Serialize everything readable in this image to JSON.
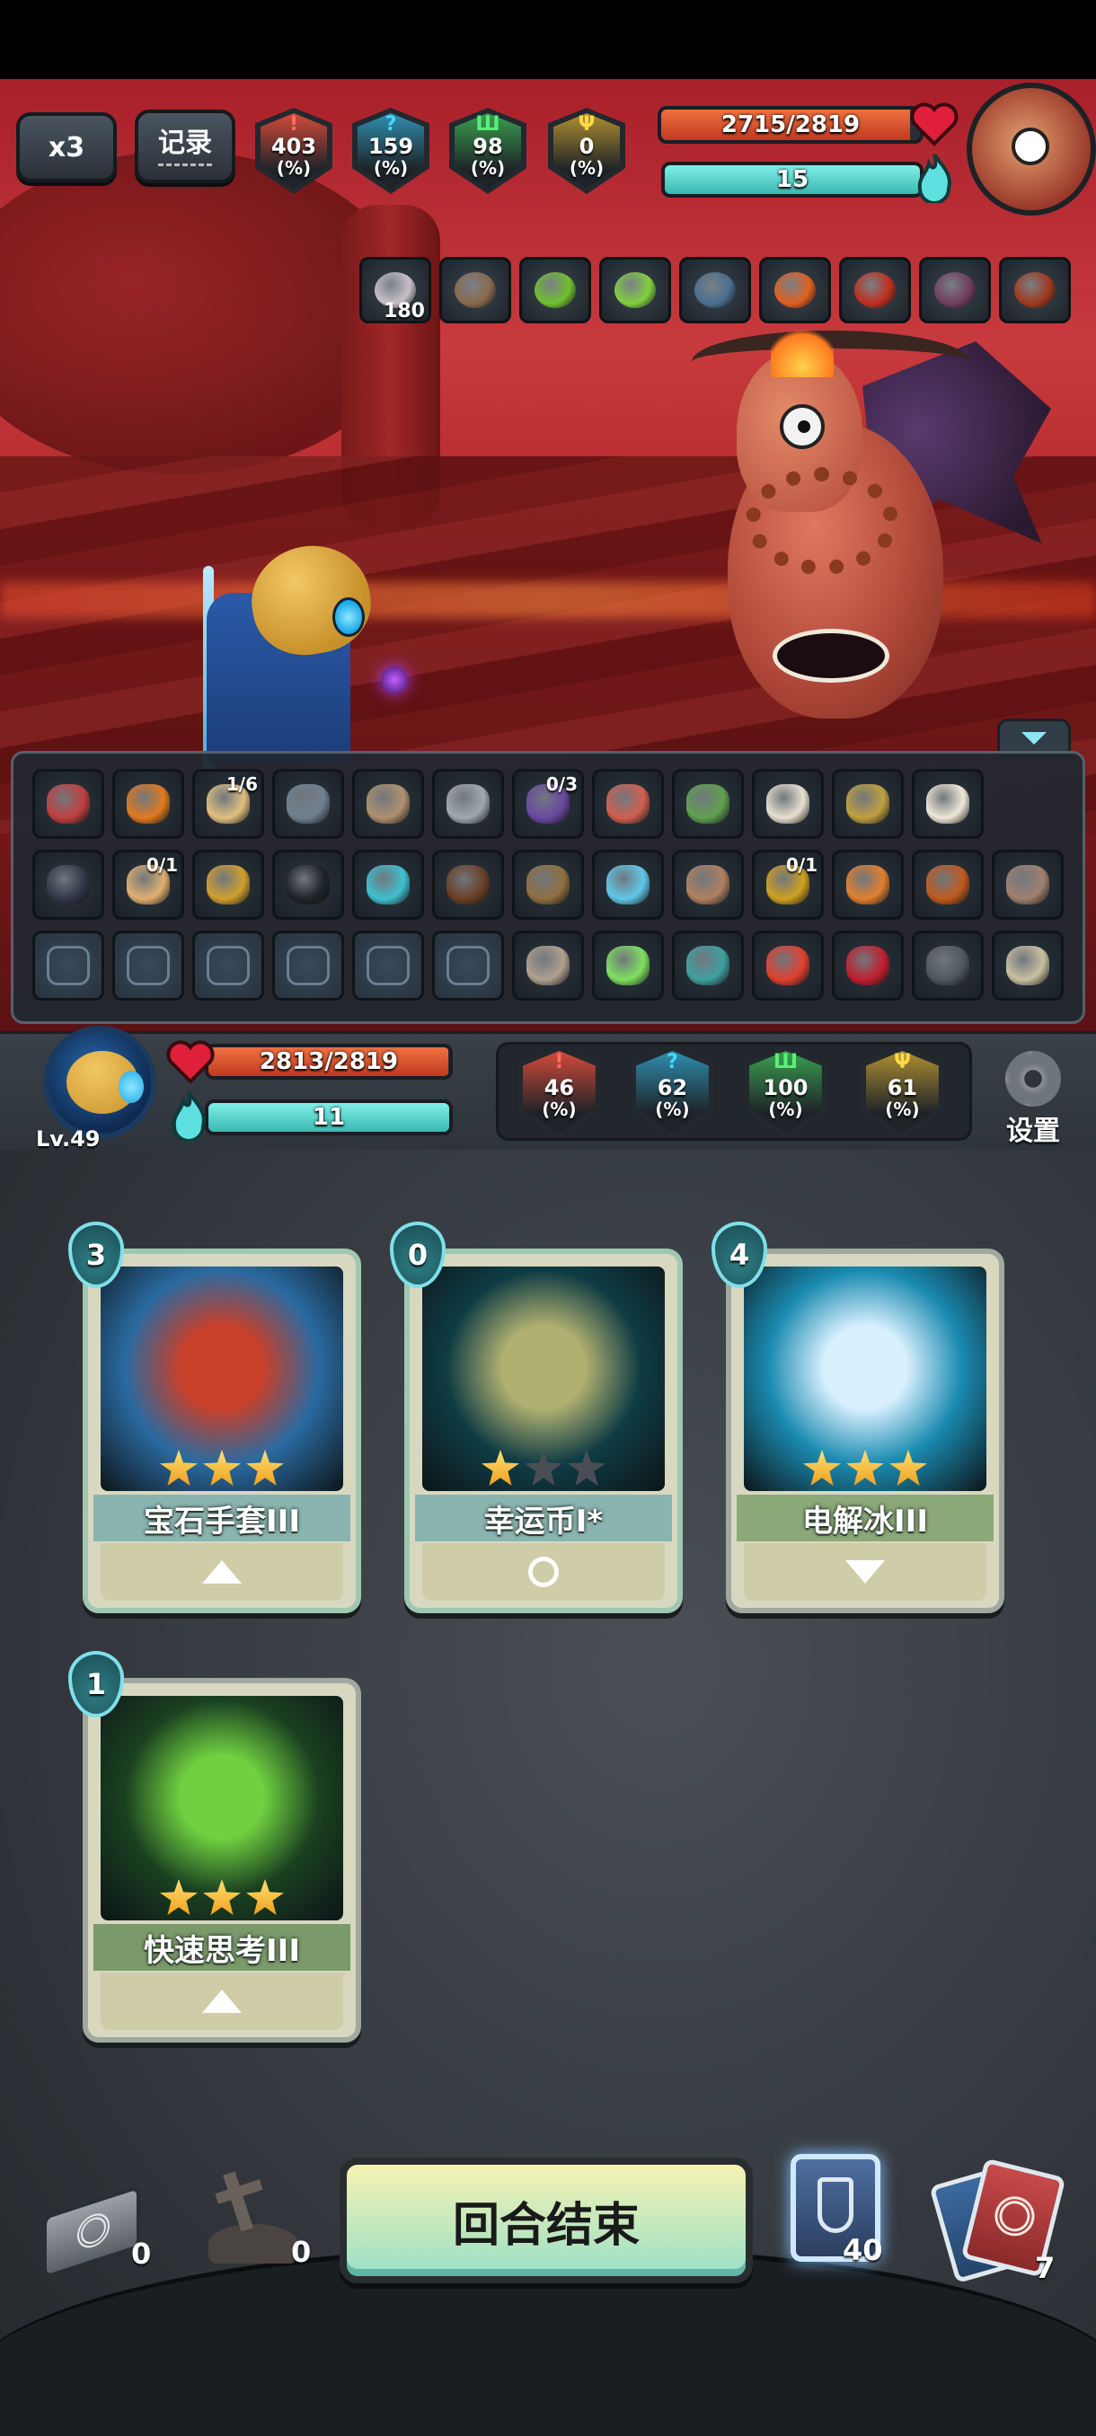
{
  "speed_button": "x3",
  "log_button": "记录",
  "enemy": {
    "stats": [
      {
        "value": "403",
        "unit": "(%)",
        "glyph": "!",
        "color": "#d44a3a"
      },
      {
        "value": "159",
        "unit": "(%)",
        "glyph": "?",
        "color": "#2f8fb0"
      },
      {
        "value": "98",
        "unit": "(%)",
        "glyph": "Ш",
        "color": "#3aa050"
      },
      {
        "value": "0",
        "unit": "(%)",
        "glyph": "Ψ",
        "color": "#b09030"
      }
    ],
    "hp": "2715/2819",
    "hp_fraction": 0.963,
    "mana": "15",
    "relics": [
      {
        "name": "spiral-token",
        "badge": "180",
        "color": "#c8c0c8"
      },
      {
        "name": "spellbook",
        "badge": "",
        "color": "#8a6a50"
      },
      {
        "name": "green-gem",
        "badge": "",
        "color": "#70c030"
      },
      {
        "name": "green-gem-2",
        "badge": "",
        "color": "#80d040"
      },
      {
        "name": "statue",
        "badge": "",
        "color": "#4a7090"
      },
      {
        "name": "flame-shard",
        "badge": "",
        "color": "#e06020"
      },
      {
        "name": "claw",
        "badge": "",
        "color": "#c03020"
      },
      {
        "name": "dark-wing",
        "badge": "",
        "color": "#704060"
      },
      {
        "name": "bead-ring",
        "badge": "",
        "color": "#a03a20"
      }
    ]
  },
  "relic_rows": [
    [
      {
        "name": "clown-face",
        "badge": "",
        "color": "#c04040"
      },
      {
        "name": "fire-torch",
        "badge": "",
        "color": "#e07a20"
      },
      {
        "name": "scroll",
        "badge": "1/6",
        "color": "#e0c080"
      },
      {
        "name": "hammer",
        "badge": "",
        "color": "#708090"
      },
      {
        "name": "mirror",
        "badge": "",
        "color": "#b09070"
      },
      {
        "name": "scales",
        "badge": "",
        "color": "#a0a8b0"
      },
      {
        "name": "tome",
        "badge": "0/3",
        "color": "#6a4aa0"
      },
      {
        "name": "doll",
        "badge": "",
        "color": "#d06050"
      },
      {
        "name": "plant-monster",
        "badge": "",
        "color": "#60a050"
      },
      {
        "name": "dice",
        "badge": "",
        "color": "#e8e0d0"
      },
      {
        "name": "compass",
        "badge": "",
        "color": "#c0a040"
      },
      {
        "name": "ice-cream",
        "badge": "",
        "color": "#f0e8d8"
      }
    ],
    [
      {
        "name": "black-wings",
        "badge": "",
        "color": "#303848"
      },
      {
        "name": "pacifier",
        "badge": "0/1",
        "color": "#e0b070"
      },
      {
        "name": "golden-lamp",
        "badge": "",
        "color": "#d0a030"
      },
      {
        "name": "sunglasses",
        "badge": "",
        "color": "#202428"
      },
      {
        "name": "cyan-orb",
        "badge": "",
        "color": "#40c0d0"
      },
      {
        "name": "sack",
        "badge": "",
        "color": "#6a4028"
      },
      {
        "name": "mask",
        "badge": "",
        "color": "#907040"
      },
      {
        "name": "ice-crystal",
        "badge": "",
        "color": "#60c8e8"
      },
      {
        "name": "shell",
        "badge": "",
        "color": "#b08060"
      },
      {
        "name": "lantern",
        "badge": "0/1",
        "color": "#d0a020"
      },
      {
        "name": "lion-head",
        "badge": "",
        "color": "#e08030"
      },
      {
        "name": "bomb-face",
        "badge": "",
        "color": "#c05a20"
      },
      {
        "name": "bird-bust",
        "badge": "",
        "color": "#a08070"
      }
    ],
    [
      {
        "name": "locked-rune-1",
        "badge": "",
        "color": "",
        "locked": true
      },
      {
        "name": "locked-rune-2",
        "badge": "",
        "color": "",
        "locked": true
      },
      {
        "name": "locked-rune-3",
        "badge": "",
        "color": "",
        "locked": true
      },
      {
        "name": "locked-rune-4",
        "badge": "",
        "color": "",
        "locked": true
      },
      {
        "name": "locked-rune-5",
        "badge": "",
        "color": "",
        "locked": true
      },
      {
        "name": "locked-rune-6",
        "badge": "",
        "color": "",
        "locked": true
      },
      {
        "name": "cauldron",
        "badge": "",
        "color": "#b0a090"
      },
      {
        "name": "green-vial",
        "badge": "",
        "color": "#80e060"
      },
      {
        "name": "fish",
        "badge": "",
        "color": "#40a0a0"
      },
      {
        "name": "strawberry",
        "badge": "",
        "color": "#e04030"
      },
      {
        "name": "red-glove",
        "badge": "",
        "color": "#c02030"
      },
      {
        "name": "bear-trap",
        "badge": "",
        "color": "#505860"
      },
      {
        "name": "bandage-mummy",
        "badge": "",
        "color": "#c8c0a0"
      }
    ]
  ],
  "player": {
    "level": "Lv.49",
    "hp": "2813/2819",
    "hp_fraction": 0.998,
    "mana": "11",
    "stats": [
      {
        "value": "46",
        "unit": "(%)",
        "glyph": "!",
        "color": "#d44a3a"
      },
      {
        "value": "62",
        "unit": "(%)",
        "glyph": "?",
        "color": "#2f8fb0"
      },
      {
        "value": "100",
        "unit": "(%)",
        "glyph": "Ш",
        "color": "#3aa050"
      },
      {
        "value": "61",
        "unit": "(%)",
        "glyph": "Ψ",
        "color": "#b09030"
      }
    ]
  },
  "settings_label": "设置",
  "cards": [
    {
      "cost": "3",
      "name": "宝石手套III",
      "stars": 3,
      "footer": "arrow-up",
      "frame": "#a0c8b0",
      "name_bg": "#8ab4b0",
      "art": [
        "#2a6aa0",
        "#c8402a"
      ]
    },
    {
      "cost": "0",
      "name": "幸运币I*",
      "stars": 1,
      "footer": "bulb",
      "frame": "#a0c8b0",
      "name_bg": "#8ab4b0",
      "art": [
        "#0f3c44",
        "#b0b070"
      ]
    },
    {
      "cost": "4",
      "name": "电解冰III",
      "stars": 3,
      "footer": "arrow-down",
      "frame": "#a0a8a0",
      "name_bg": "#8aa878",
      "art": [
        "#1a8ab0",
        "#d8f0ff"
      ]
    },
    {
      "cost": "1",
      "name": "快速思考III",
      "stars": 3,
      "footer": "arrow-up",
      "frame": "#a0a8a0",
      "name_bg": "#7a9a6a",
      "art": [
        "#1a4020",
        "#70d040"
      ]
    }
  ],
  "bottom": {
    "end_turn": "回合结束",
    "exhaust_count": "0",
    "discard_count": "0",
    "potion_count": "40",
    "draw_count": "7"
  }
}
